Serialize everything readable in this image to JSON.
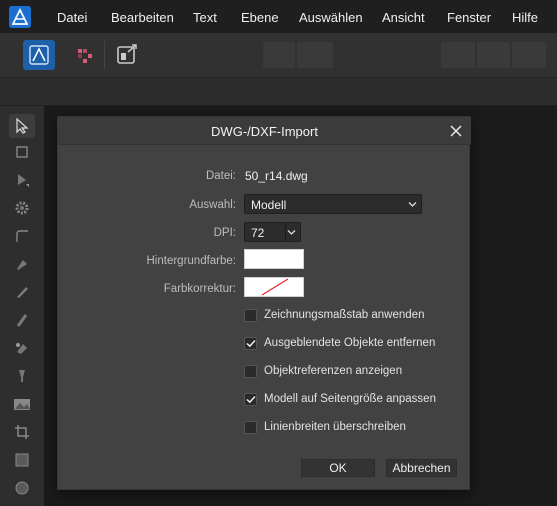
{
  "menu": {
    "items": [
      "Datei",
      "Bearbeiten",
      "Text",
      "Ebene",
      "Auswählen",
      "Ansicht",
      "Fenster",
      "Hilfe"
    ]
  },
  "toolbar": {
    "icons": [
      "affinity-designer-persona-icon",
      "pixel-persona-icon",
      "export-persona-icon"
    ]
  },
  "tools": [
    "move-tool-icon",
    "artboard-tool-icon",
    "node-tool-icon",
    "gear-tool-icon",
    "corner-tool-icon",
    "pen-tool-icon",
    "pencil-tool-icon",
    "brush-tool-icon",
    "fill-tool-icon",
    "transparency-tool-icon",
    "place-image-tool-icon",
    "crop-tool-icon",
    "rectangle-tool-icon",
    "ellipse-tool-icon"
  ],
  "dialog": {
    "title": "DWG-/DXF-Import",
    "file_label": "Datei:",
    "file_value": "50_r14.dwg",
    "selection_label": "Auswahl:",
    "selection_value": "Modell",
    "dpi_label": "DPI:",
    "dpi_value": "72",
    "background_label": "Hintergrundfarbe:",
    "color_correction_label": "Farbkorrektur:",
    "checkboxes": [
      {
        "label": "Zeichnungsmaßstab anwenden",
        "checked": false
      },
      {
        "label": "Ausgeblendete Objekte entfernen",
        "checked": true
      },
      {
        "label": "Objektreferenzen anzeigen",
        "checked": false
      },
      {
        "label": "Modell auf Seitengröße anpassen",
        "checked": true
      },
      {
        "label": "Linienbreiten überschreiben",
        "checked": false
      }
    ],
    "ok_label": "OK",
    "cancel_label": "Abbrechen"
  },
  "colors": {
    "accent": "#1d5fa8",
    "dialog_bg": "#424242",
    "no_color_slash": "#e0242a"
  }
}
